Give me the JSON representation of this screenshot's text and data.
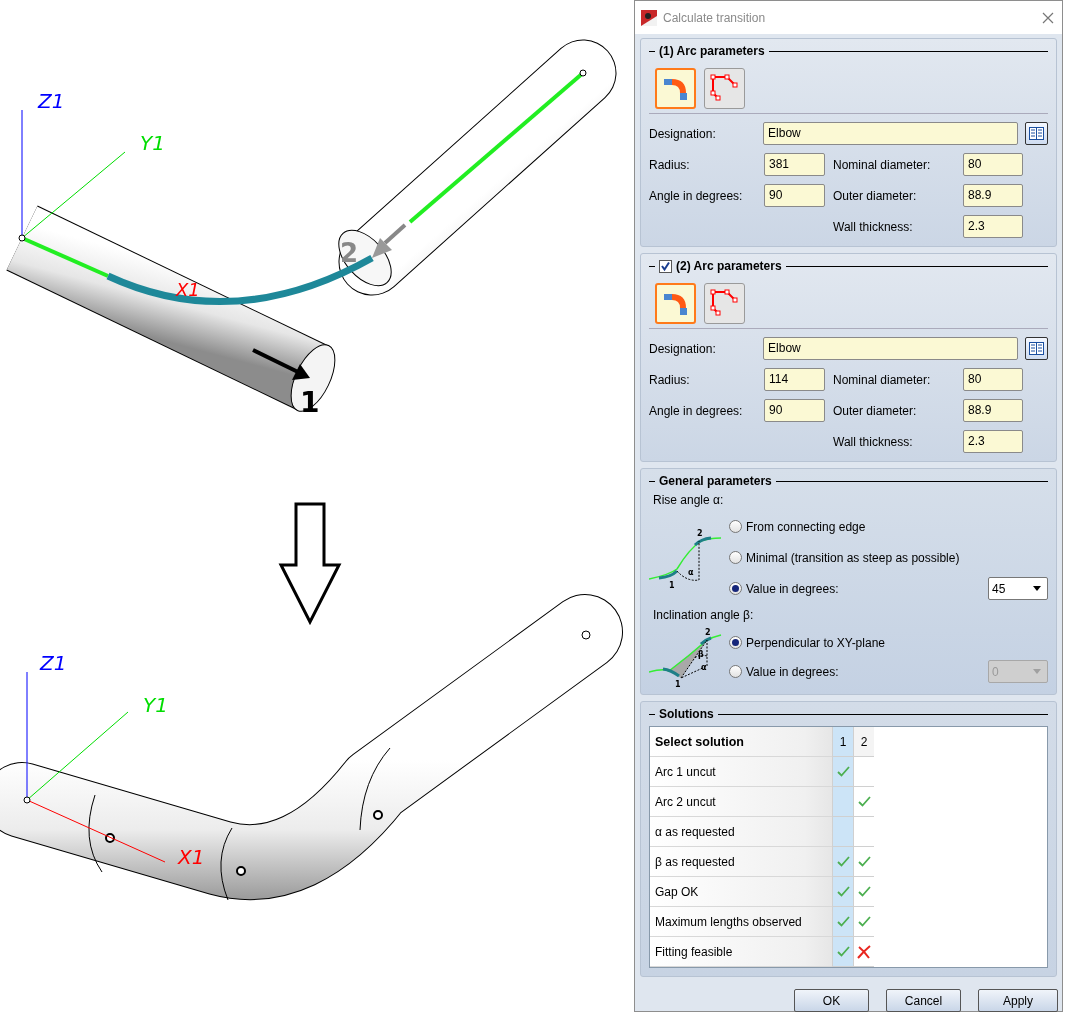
{
  "illustration": {
    "before": {
      "z_label": "Z1",
      "y_label": "Y1",
      "x_label": "X1",
      "start_marker": "1",
      "end_marker": "2"
    },
    "after": {
      "z_label": "Z1",
      "y_label": "Y1",
      "x_label": "X1"
    }
  },
  "dialog": {
    "title": "Calculate transition",
    "arc_sections": [
      {
        "title": "(1) Arc parameters",
        "modes": [
          {
            "kind": "fitting",
            "selected": true
          },
          {
            "kind": "polyline",
            "selected": false
          }
        ],
        "designation": {
          "label": "Designation:",
          "value": "Elbow"
        },
        "radius": {
          "label": "Radius:",
          "value": "381"
        },
        "angle": {
          "label": "Angle in degrees:",
          "value": "90"
        },
        "nominal_diameter": {
          "label": "Nominal diameter:",
          "value": "80"
        },
        "outer_diameter": {
          "label": "Outer diameter:",
          "value": "88.9"
        },
        "wall_thickness": {
          "label": "Wall thickness:",
          "value": "2.3"
        }
      },
      {
        "title": "(2) Arc parameters",
        "checked": true,
        "modes": [
          {
            "kind": "fitting",
            "selected": true
          },
          {
            "kind": "polyline",
            "selected": false
          }
        ],
        "designation": {
          "label": "Designation:",
          "value": "Elbow"
        },
        "radius": {
          "label": "Radius:",
          "value": "114"
        },
        "angle": {
          "label": "Angle in degrees:",
          "value": "90"
        },
        "nominal_diameter": {
          "label": "Nominal diameter:",
          "value": "80"
        },
        "outer_diameter": {
          "label": "Outer diameter:",
          "value": "88.9"
        },
        "wall_thickness": {
          "label": "Wall thickness:",
          "value": "2.3"
        }
      }
    ],
    "general": {
      "title": "General parameters",
      "rise_angle": {
        "label": "Rise angle α:",
        "diagram_labels": [
          "2",
          "α",
          "1"
        ],
        "options": [
          {
            "label": "From connecting edge",
            "selected": false
          },
          {
            "label": "Minimal (transition as steep as possible)",
            "selected": false
          },
          {
            "label": "Value in degrees:",
            "selected": true
          }
        ],
        "value": "45",
        "disabled": false
      },
      "inclination_angle": {
        "label": "Inclination angle β:",
        "diagram_labels": [
          "2",
          "β",
          "α",
          "1"
        ],
        "options": [
          {
            "label": "Perpendicular to XY-plane",
            "selected": true
          },
          {
            "label": "Value in degrees:",
            "selected": false
          }
        ],
        "value": "0",
        "disabled": true
      }
    },
    "solutions": {
      "title": "Solutions",
      "header": "Select solution",
      "columns": [
        {
          "label": "1",
          "selected": true
        },
        {
          "label": "2",
          "selected": false
        }
      ],
      "rows": [
        {
          "label": "Arc 1 uncut",
          "results": [
            {
              "kind": "check"
            },
            {
              "kind": "empty"
            }
          ]
        },
        {
          "label": "Arc 2 uncut",
          "results": [
            {
              "kind": "empty"
            },
            {
              "kind": "check"
            }
          ]
        },
        {
          "label": "α as requested",
          "results": [
            {
              "kind": "empty"
            },
            {
              "kind": "empty"
            }
          ]
        },
        {
          "label": "β as requested",
          "results": [
            {
              "kind": "check"
            },
            {
              "kind": "check"
            }
          ]
        },
        {
          "label": "Gap OK",
          "results": [
            {
              "kind": "check"
            },
            {
              "kind": "check"
            }
          ]
        },
        {
          "label": "Maximum lengths observed",
          "results": [
            {
              "kind": "check"
            },
            {
              "kind": "check"
            }
          ]
        },
        {
          "label": "Fitting feasible",
          "results": [
            {
              "kind": "check"
            },
            {
              "kind": "cross"
            }
          ]
        }
      ]
    },
    "buttons": [
      "OK",
      "Cancel",
      "Apply"
    ]
  }
}
